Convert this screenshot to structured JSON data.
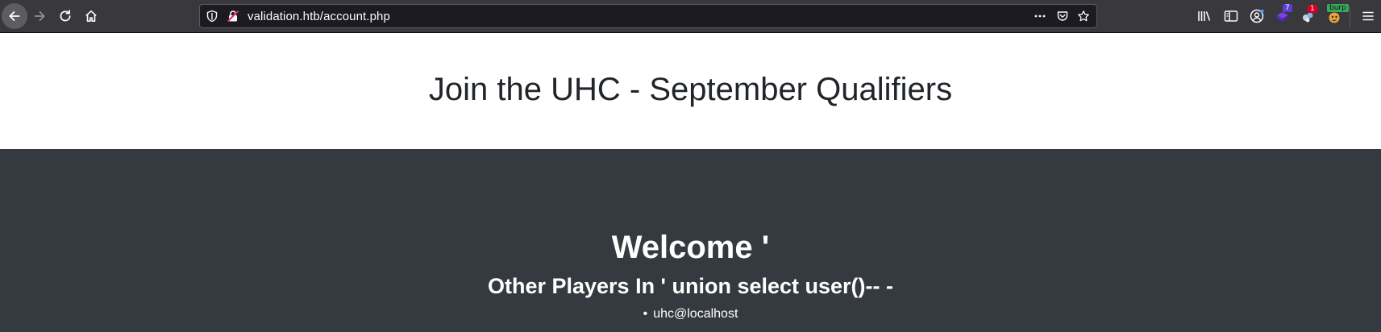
{
  "browser": {
    "url": "validation.htb/account.php",
    "extensions": {
      "ext1_badge": "7",
      "ext2_badge": "1",
      "burp_badge": "burp"
    }
  },
  "page": {
    "title": "Join the UHC - September Qualifiers",
    "welcome": "Welcome '",
    "players_heading": "Other Players In ' union select user()-- -",
    "players": [
      "uhc@localhost"
    ]
  },
  "colors": {
    "hero_bg": "#ffffff",
    "dark_bg": "#343a40",
    "text_dark": "#212529",
    "toolbar_bg": "#38383d"
  }
}
